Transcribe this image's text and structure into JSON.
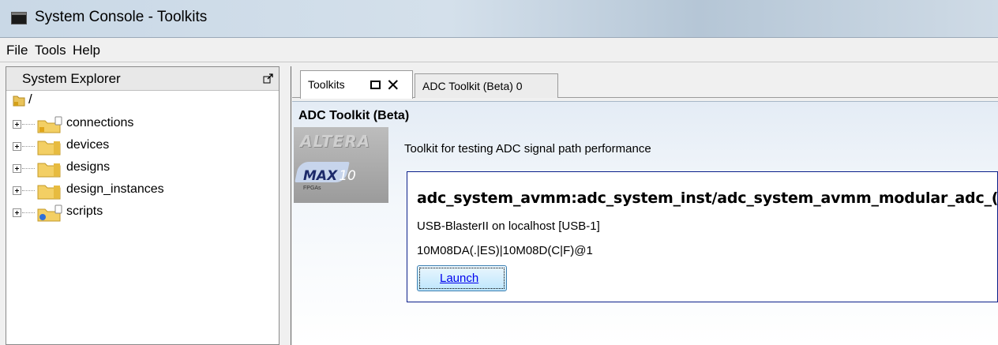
{
  "window": {
    "title": "System Console - Toolkits"
  },
  "menu": [
    "File",
    "Tools",
    "Help"
  ],
  "explorer": {
    "title": "System Explorer",
    "root": "/",
    "items": [
      {
        "label": "connections",
        "icon": "folder-lock-icon"
      },
      {
        "label": "devices",
        "icon": "folder-icon"
      },
      {
        "label": "designs",
        "icon": "folder-icon"
      },
      {
        "label": "design_instances",
        "icon": "folder-icon"
      },
      {
        "label": "scripts",
        "icon": "folder-info-icon"
      }
    ]
  },
  "tabs": [
    {
      "label": "Toolkits",
      "active": true
    },
    {
      "label": "ADC Toolkit (Beta) 0",
      "active": false
    }
  ],
  "toolkit": {
    "title": "ADC Toolkit (Beta)",
    "description": "Toolkit for testing ADC signal path performance",
    "logo": {
      "brand": "ALTERA",
      "product": "MAX",
      "product_suffix": "10",
      "tagline": "FPGAs"
    },
    "device": {
      "path": "adc_system_avmm:adc_system_inst/adc_system_avmm_modular_adc_(",
      "connection": "USB-BlasterII on localhost [USB-1]",
      "part": "10M08DA(.|ES)|10M08D(C|F)@1",
      "launch_label": "Launch"
    }
  },
  "colors": {
    "device_card_border": "#0a1f8a",
    "link": "#0000ee"
  }
}
